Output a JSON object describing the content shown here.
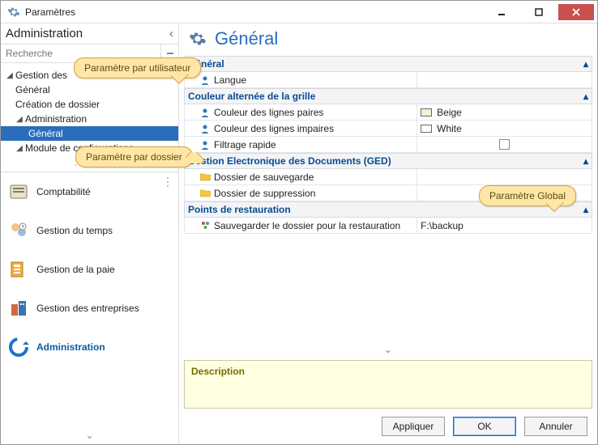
{
  "window": {
    "title": "Paramètres"
  },
  "sidebar": {
    "header": "Administration",
    "search_placeholder": "Recherche",
    "tree": {
      "root": {
        "label": "Gestion des"
      },
      "c0": {
        "label": "Général"
      },
      "c1": {
        "label": "Création de dossier"
      },
      "admin": {
        "label": "Administration"
      },
      "adminc": {
        "label": "Général"
      },
      "mod": {
        "label": "Module de configurations"
      },
      "dots": "......"
    },
    "modules": [
      {
        "label": "Comptabilité"
      },
      {
        "label": "Gestion du temps"
      },
      {
        "label": "Gestion de la paie"
      },
      {
        "label": "Gestion des entreprises"
      },
      {
        "label": "Administration"
      }
    ]
  },
  "content": {
    "title": "Général",
    "categories": {
      "general": {
        "label": "Général"
      },
      "grid": {
        "label": "Couleur alternée de la grille"
      },
      "ged": {
        "label": "Gestion Electronique des Documents (GED)"
      },
      "restore": {
        "label": "Points de restauration"
      }
    },
    "props": {
      "langue": {
        "label": "Langue",
        "value": ""
      },
      "pair": {
        "label": "Couleur des lignes paires",
        "value": "Beige",
        "swatch": "#f5f0d4"
      },
      "impair": {
        "label": "Couleur des lignes impaires",
        "value": "White",
        "swatch": "#ffffff"
      },
      "filtrage": {
        "label": "Filtrage rapide",
        "checked": false
      },
      "dossier_save": {
        "label": "Dossier de sauvegarde",
        "value": ""
      },
      "dossier_supp": {
        "label": "Dossier de suppression",
        "value": ""
      },
      "restore_path": {
        "label": "Sauvegarder le dossier pour la restauration",
        "value": "F:\\backup"
      }
    },
    "description_label": "Description"
  },
  "callouts": {
    "user": "Paramètre par utilisateur",
    "folder": "Paramètre par dossier",
    "global": "Paramètre Global"
  },
  "buttons": {
    "apply": "Appliquer",
    "ok": "OK",
    "cancel": "Annuler"
  }
}
